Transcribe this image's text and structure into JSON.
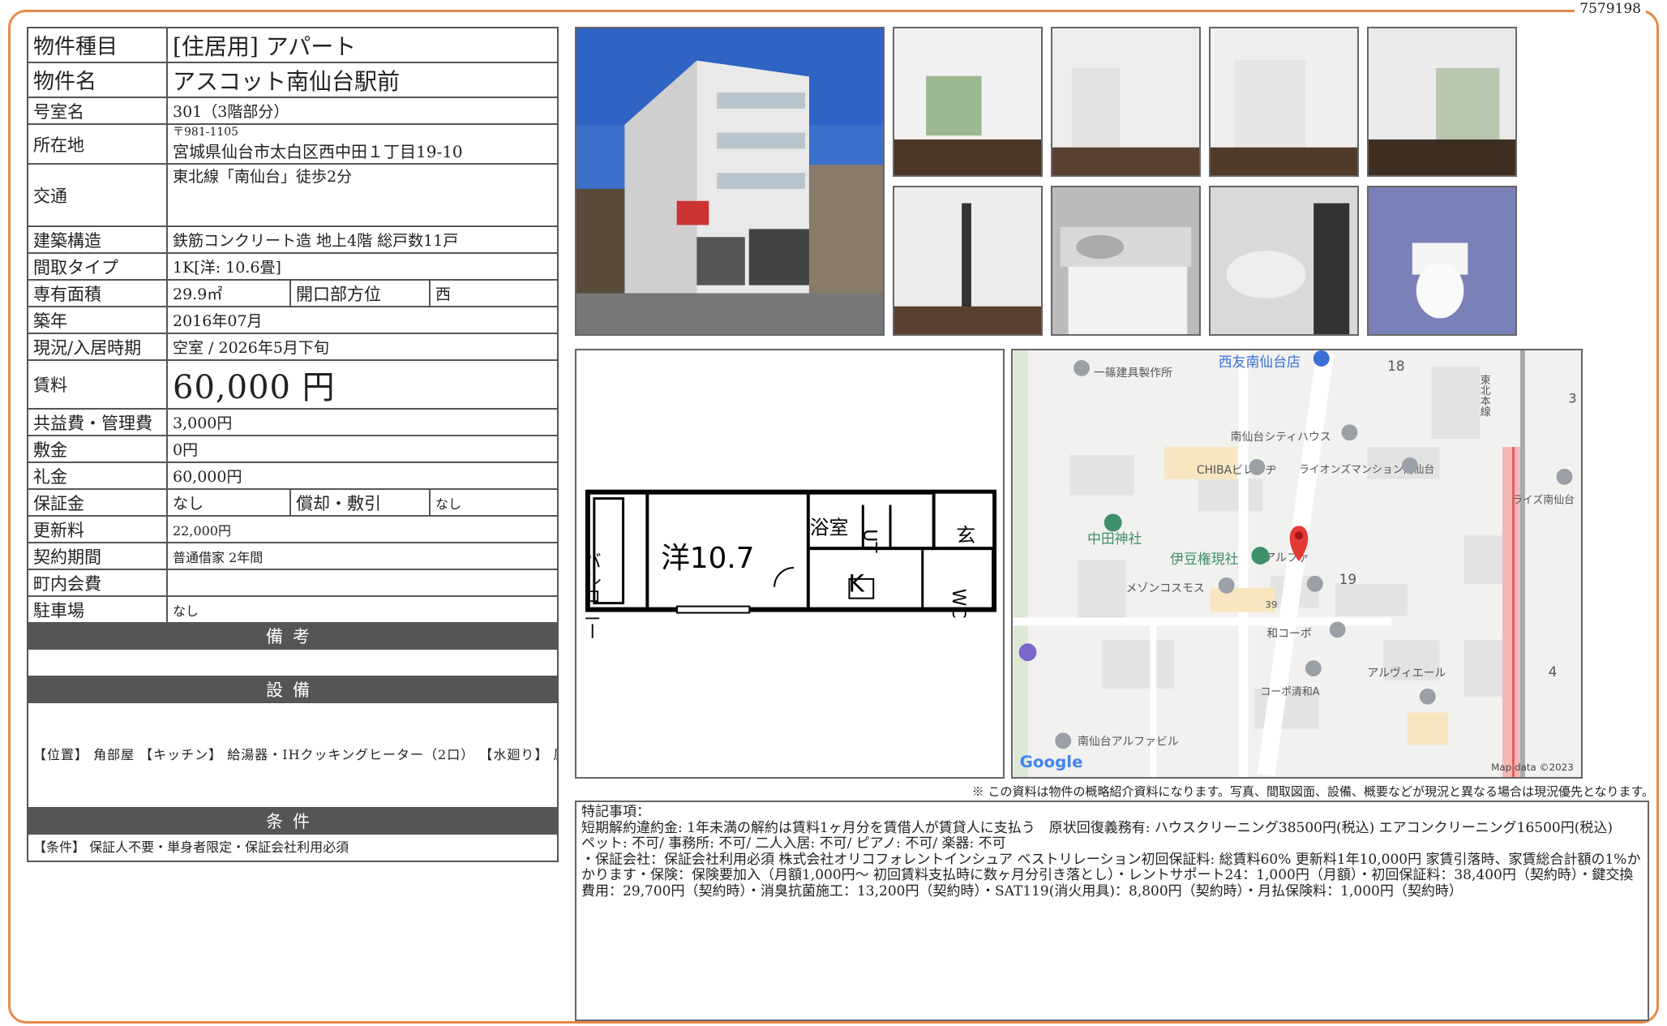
{
  "doc_id": "7579198",
  "table": {
    "type_label": "物件種目",
    "type_value": "[住居用]  アパート",
    "name_label": "物件名",
    "name_value": "アスコット南仙台駅前",
    "room_label": "号室名",
    "room_value": "301（3階部分）",
    "address_label": "所在地",
    "zip": "〒981-1105",
    "address": "宮城県仙台市太白区西中田１丁目19-10",
    "access_label": "交通",
    "access_value": "東北線「南仙台」徒歩2分",
    "structure_label": "建築構造",
    "structure_value": "鉄筋コンクリート造  地上4階  総戸数11戸",
    "layout_label": "間取タイプ",
    "layout_value": "1K[洋: 10.6畳]",
    "area_label": "専有面積",
    "area_value": "29.9㎡",
    "direction_label": "開口部方位",
    "direction_value": "西",
    "built_label": "築年",
    "built_value": "2016年07月",
    "status_label": "現況/入居時期",
    "status_value": "空室  /  2026年5月下旬",
    "rent_label": "賃料",
    "rent_value": "60,000 円",
    "fee_label": "共益費・管理費",
    "fee_value": "3,000円",
    "deposit_label": "敷金",
    "deposit_value": "0円",
    "keymoney_label": "礼金",
    "keymoney_value": "60,000円",
    "guarantee_label": "保証金",
    "guarantee_value": "なし",
    "amort_label": "償却・敷引",
    "amort_value": "なし",
    "renewal_label": "更新料",
    "renewal_value": "22,000円",
    "contract_label": "契約期間",
    "contract_value": "普通借家  2年間",
    "assoc_label": "町内会費",
    "assoc_value": "",
    "parking_label": "駐車場",
    "parking_value": "なし",
    "remarks_header": "備考",
    "remarks_value": "",
    "equip_header": "設備",
    "equip_text": "【位置】 角部屋 【キッチン】 給湯器・IHクッキングヒーター（2口） 【水廻り】 風呂・トイレ（水洗）・シャワートイレ・追い焚き・洗髪洗面化粧台・バス・トイレ別・洗濯機置場（室内） 【冷暖房】 エアコン 【収納】 シューズボックス 【放送・通信】 ネット使用料不要 【セキュリティ】 オートロック・インターホン（カメラ付き） 【その他】 ガス（プロパンガス）・水道（公営）・排水（公共下水）・バルコニー／ベランダ",
    "cond_header": "条件",
    "cond_text": "【条件】 保証人不要・単身者限定・保証会社利用必須"
  },
  "floorplan": {
    "balcony": "バルコニー",
    "western": "洋10.7",
    "bath": "浴室",
    "ut": "UT",
    "kitchen": "K",
    "entry": "玄",
    "wc": "WC"
  },
  "map": {
    "labels": [
      "西友南仙台店",
      "18",
      "一篠建具製作所",
      "南仙台シティハウス",
      "CHIBAビレッヂ",
      "ライオンズマンション南仙台",
      "ライズ南仙台",
      "中田神社",
      "伊豆権現社",
      "アルファ",
      "19",
      "メゾンコスモス",
      "39",
      "和コーポ",
      "コーポ清和A",
      "アルヴィエール",
      "南仙台アルファビル",
      "3",
      "4",
      "東北本線"
    ],
    "google": "Google",
    "mapdata": "Map data ©2023"
  },
  "disclaimer": "※ この資料は物件の概略紹介資料になります。写真、間取図面、設備、概要などが現況と異なる場合は現況優先となります。",
  "notes": {
    "title": "特記事項：",
    "line1": "短期解約違約金: 1年未満の解約は賃料1ヶ月分を賃借人が賃貸人に支払う　原状回復義務有: ハウスクリーニング38500円(税込) エアコンクリーニング16500円(税込)",
    "line2": "ペット: 不可/ 事務所: 不可/ 二人入居: 不可/ ピアノ: 不可/ 楽器: 不可",
    "line3": "・保証会社：保証会社利用必須  株式会社オリコフォレントインシュア  ベストリレーション初回保証料: 総賃料60%  更新料1年10,000円  家賃引落時、家賃総合計額の1%かかります・保険：保険要加入（月額1,000円～  初回賃料支払時に数ヶ月分引き落とし）・レントサポート24：1,000円（月額）・初回保証料：38,400円（契約時）・鍵交換費用：29,700円（契約時）・消臭抗菌施工：13,200円（契約時）・SAT119(消火用具)：8,800円（契約時）・月払保険料：1,000円（契約時）"
  }
}
